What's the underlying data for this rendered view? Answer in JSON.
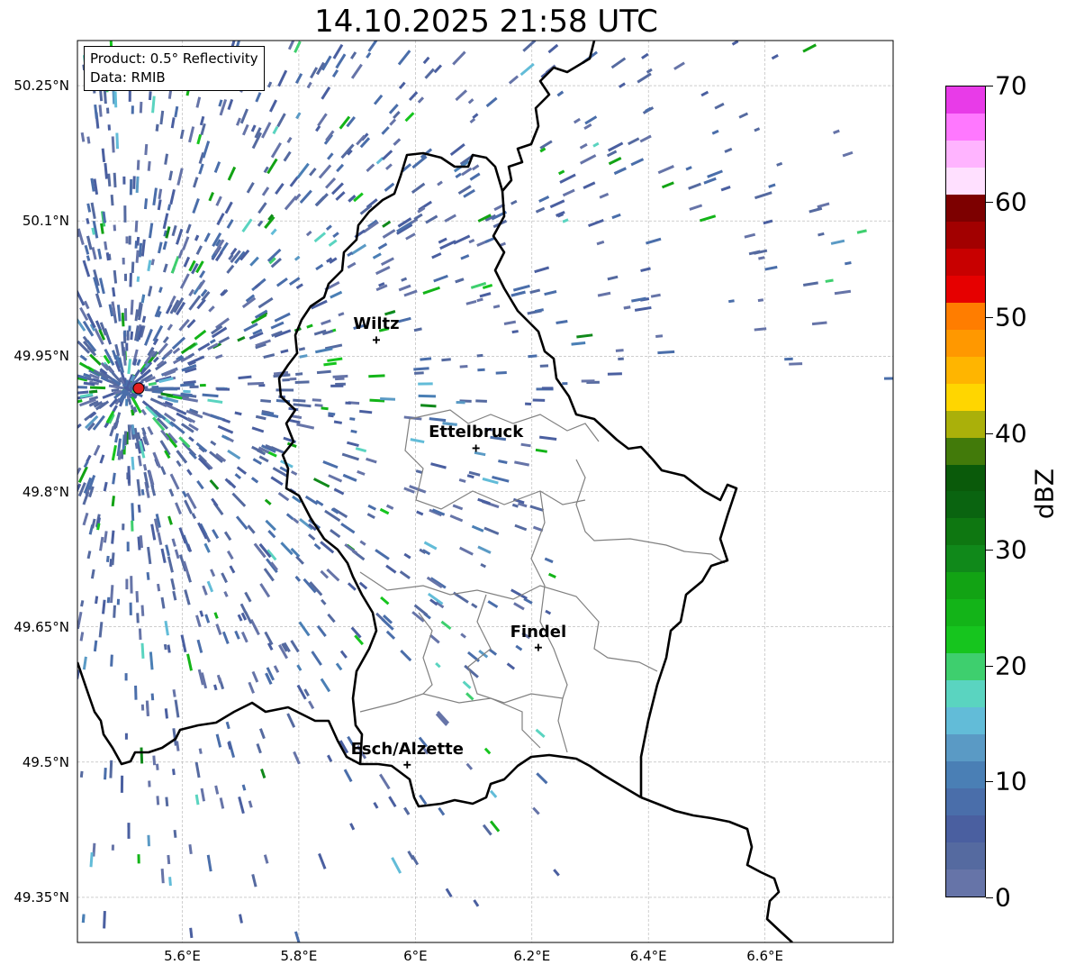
{
  "title": "14.10.2025 21:58 UTC",
  "info": {
    "product": "Product: 0.5° Reflectivity",
    "source": "Data: RMIB"
  },
  "map": {
    "lon_range": [
      5.42,
      6.82
    ],
    "lat_range": [
      49.3,
      50.3
    ],
    "lat_ticks": [
      {
        "value": 50.25,
        "label": "50.25°N"
      },
      {
        "value": 50.1,
        "label": "50.1°N"
      },
      {
        "value": 49.95,
        "label": "49.95°N"
      },
      {
        "value": 49.8,
        "label": "49.8°N"
      },
      {
        "value": 49.65,
        "label": "49.65°N"
      },
      {
        "value": 49.5,
        "label": "49.5°N"
      },
      {
        "value": 49.35,
        "label": "49.35°N"
      }
    ],
    "lon_ticks": [
      {
        "value": 5.6,
        "label": "5.6°E"
      },
      {
        "value": 5.8,
        "label": "5.8°E"
      },
      {
        "value": 6.0,
        "label": "6°E"
      },
      {
        "value": 6.2,
        "label": "6.2°E"
      },
      {
        "value": 6.4,
        "label": "6.4°E"
      },
      {
        "value": 6.6,
        "label": "6.6°E"
      }
    ],
    "grid": true,
    "radar_site": {
      "lon": 5.505,
      "lat": 49.914
    },
    "cities": [
      {
        "name": "Wiltz",
        "lon": 5.933,
        "lat": 49.968
      },
      {
        "name": "Ettelbruck",
        "lon": 6.104,
        "lat": 49.848
      },
      {
        "name": "Findel",
        "lon": 6.211,
        "lat": 49.627
      },
      {
        "name": "Esch/Alzette",
        "lon": 5.986,
        "lat": 49.497
      }
    ]
  },
  "colorbar": {
    "unit": "dBZ",
    "min": 0,
    "max": 70,
    "tick_labels": [
      "0",
      "10",
      "20",
      "30",
      "40",
      "50",
      "60",
      "70"
    ],
    "colors": [
      "#6674a8",
      "#556aa0",
      "#4a5fa0",
      "#4a6eaa",
      "#4a7fb5",
      "#5a9ac5",
      "#62bcd8",
      "#5ad4c0",
      "#3ecf6e",
      "#16c51e",
      "#13b418",
      "#12a314",
      "#10891a",
      "#0e7711",
      "#0a6410",
      "#0a5a0a",
      "#427a0a",
      "#aab00a",
      "#ffd600",
      "#ffb500",
      "#ff9800",
      "#ff7d00",
      "#e60000",
      "#c80000",
      "#a20000",
      "#7d0000",
      "#ffe0ff",
      "#ffb4ff",
      "#ff78ff",
      "#e83be8"
    ]
  },
  "legend_colors": {
    "echo_dominant": "#5d74aa",
    "border_national": "#000000",
    "border_regional": "#808080",
    "radar_marker": "#e32020"
  }
}
